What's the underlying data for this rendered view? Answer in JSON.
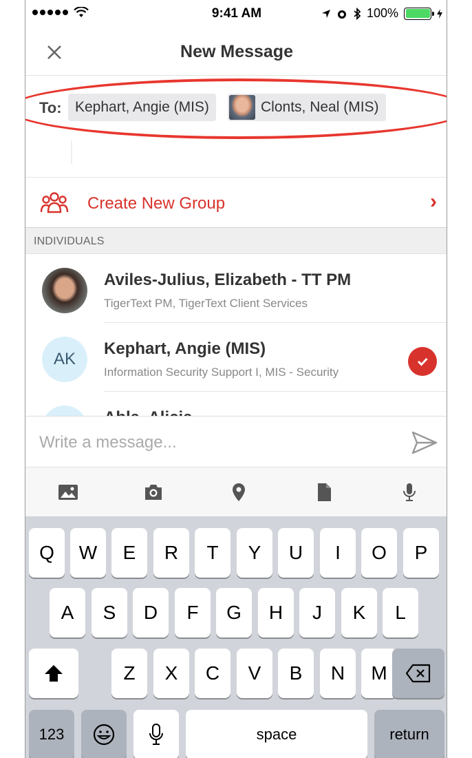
{
  "status_bar": {
    "time": "9:41 AM",
    "battery": "100%",
    "battery_level": 1.0,
    "icons": [
      "signal-dots-icon",
      "wifi-icon",
      "location-arrow-icon",
      "alarm-icon",
      "bluetooth-icon",
      "battery-icon",
      "charging-icon"
    ]
  },
  "nav": {
    "title": "New Message",
    "close_icon": "close-icon"
  },
  "recipients": {
    "label": "To:",
    "chips": [
      "Kephart, Angie (MIS)",
      "Clonts, Neal (MIS)"
    ]
  },
  "create_group": {
    "label": "Create New Group",
    "icon": "group-icon",
    "chevron": "›"
  },
  "section": {
    "header": "INDIVIDUALS"
  },
  "contacts": [
    {
      "name": "Aviles-Julius, Elizabeth - TT PM",
      "subtitle": "TigerText PM, TigerText Client Services",
      "avatar": "photo",
      "selected": false
    },
    {
      "name": "Kephart, Angie (MIS)",
      "subtitle": "Information Security Support I, MIS - Security",
      "initials": "AK",
      "selected": true
    },
    {
      "name": "Abla, Alicia",
      "subtitle": "",
      "selected": false
    }
  ],
  "composer": {
    "placeholder": "Write a message...",
    "send_icon": "send-icon"
  },
  "attachments": [
    "image-icon",
    "camera-icon",
    "location-pin-icon",
    "document-icon",
    "microphone-icon"
  ],
  "keyboard": {
    "row1": [
      "Q",
      "W",
      "E",
      "R",
      "T",
      "Y",
      "U",
      "I",
      "O",
      "P"
    ],
    "row2": [
      "A",
      "S",
      "D",
      "F",
      "G",
      "H",
      "J",
      "K",
      "L"
    ],
    "row3": [
      "Z",
      "X",
      "C",
      "V",
      "B",
      "N",
      "M"
    ],
    "numbers_key": "123",
    "space_key": "space",
    "return_key": "return"
  },
  "colors": {
    "accent": "#d8322c",
    "highlight_oval": "#e8362e",
    "keyboard_bg": "#d1d4da",
    "initials_avatar_bg": "#d9f0fb"
  }
}
